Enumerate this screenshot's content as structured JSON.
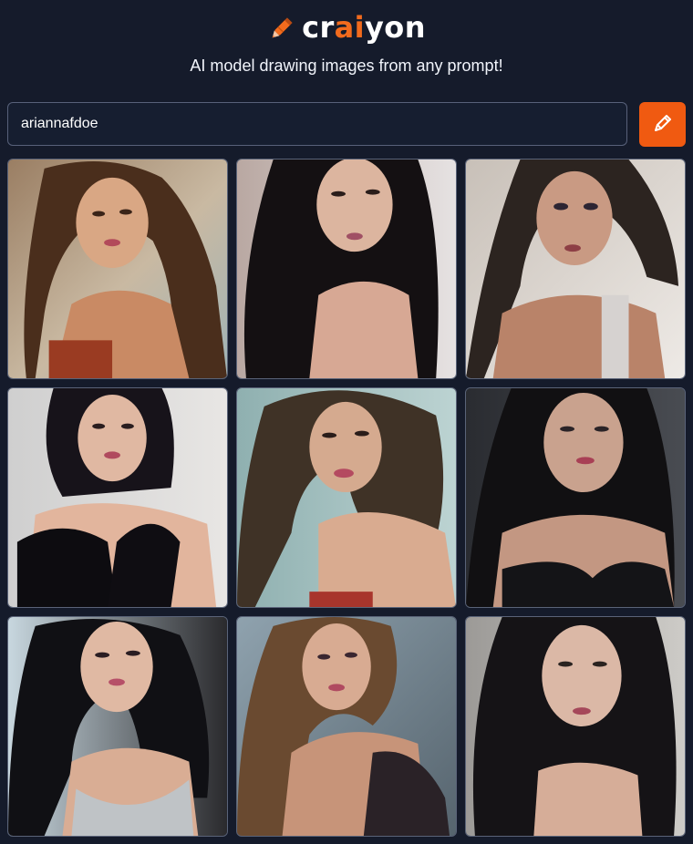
{
  "header": {
    "brand_parts": [
      "cr",
      "ai",
      "yon"
    ],
    "tagline": "AI model drawing images from any prompt!",
    "accent_color": "#f26b1d"
  },
  "search": {
    "value": "ariannafdoe",
    "placeholder": "",
    "submit_icon": "pencil-icon"
  },
  "results": {
    "images": [
      {
        "alt": "",
        "icon": "generated-image"
      },
      {
        "alt": "",
        "icon": "generated-image"
      },
      {
        "alt": "",
        "icon": "generated-image"
      },
      {
        "alt": "",
        "icon": "generated-image"
      },
      {
        "alt": "",
        "icon": "generated-image"
      },
      {
        "alt": "",
        "icon": "generated-image"
      },
      {
        "alt": "",
        "icon": "generated-image"
      },
      {
        "alt": "",
        "icon": "generated-image"
      },
      {
        "alt": "",
        "icon": "generated-image"
      }
    ]
  },
  "colors": {
    "background": "#151b2b",
    "button": "#f05a11",
    "tile_border": "#5a6378"
  }
}
